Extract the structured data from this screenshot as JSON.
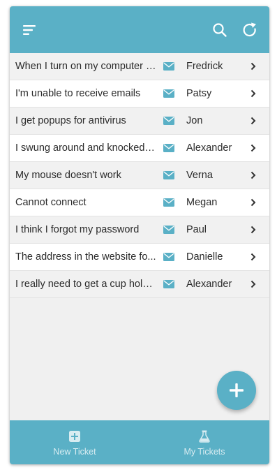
{
  "colors": {
    "accent": "#5ab0c6",
    "list_bg": "#f0f0f0",
    "text": "#2b2b2b"
  },
  "header": {
    "menu_icon": "menu-icon",
    "search_icon": "search-icon",
    "refresh_icon": "refresh-icon"
  },
  "tickets": [
    {
      "subject": "When I turn on my computer t...",
      "assignee": "Fredrick"
    },
    {
      "subject": "I'm unable to receive emails",
      "assignee": "Patsy"
    },
    {
      "subject": "I get popups for antivirus",
      "assignee": "Jon"
    },
    {
      "subject": "I swung around and knocked o...",
      "assignee": "Alexander"
    },
    {
      "subject": "My mouse doesn't work",
      "assignee": "Verna"
    },
    {
      "subject": "Cannot connect",
      "assignee": "Megan"
    },
    {
      "subject": "I think I forgot my password",
      "assignee": "Paul"
    },
    {
      "subject": "The address in the website fo...",
      "assignee": "Danielle"
    },
    {
      "subject": "I really need to get a cup holder",
      "assignee": "Alexander"
    }
  ],
  "fab": {
    "icon": "plus-icon"
  },
  "bottom_nav": {
    "tabs": [
      {
        "label": "New Ticket",
        "icon": "plus-square-icon"
      },
      {
        "label": "My Tickets",
        "icon": "flask-icon"
      }
    ]
  }
}
